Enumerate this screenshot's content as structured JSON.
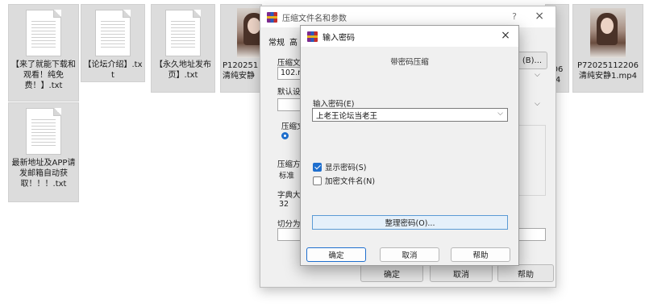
{
  "files": [
    {
      "name": "【来了就能下载和观看！纯免费！】.txt",
      "kind": "text"
    },
    {
      "name": "【论坛介绍】.txt",
      "kind": "text"
    },
    {
      "name": "【永久地址发布页】.txt",
      "kind": "text"
    },
    {
      "name": "P120251 清纯安静",
      "kind": "photo"
    },
    {
      "name": "06 4",
      "kind": "partial"
    },
    {
      "name": "P72025112206 清纯安静1.mp4",
      "kind": "photo"
    },
    {
      "name": "最新地址及APP请发邮箱自动获取！！！.txt",
      "kind": "text"
    }
  ],
  "bg_dialog": {
    "title": "压缩文件名和参数",
    "help_icon": "?",
    "close_icon": "×",
    "tab_general": "常规",
    "tab_advanced": "高",
    "label_archive_name": "压缩文件",
    "archive_name_value": "102.ra",
    "browse_button": "(B)...",
    "label_profile": "默认设置",
    "label_format": "压缩文",
    "label_method": "压缩方式",
    "method_value": "标准",
    "label_dict": "字典大小",
    "dict_value": "32",
    "label_split": "切分为分",
    "ok": "确定",
    "cancel": "取消",
    "help": "帮助"
  },
  "pwd_dialog": {
    "title": "输入密码",
    "close_icon": "×",
    "subtitle": "带密码压缩",
    "enter_label": "输入密码(E)",
    "password_value": "上老王论坛当老王",
    "show_password": "显示密码(S)",
    "encrypt_names": "加密文件名(N)",
    "organize_button": "整理密码(O)...",
    "ok": "确定",
    "cancel": "取消",
    "help": "帮助",
    "show_password_checked": true,
    "encrypt_names_checked": false
  }
}
